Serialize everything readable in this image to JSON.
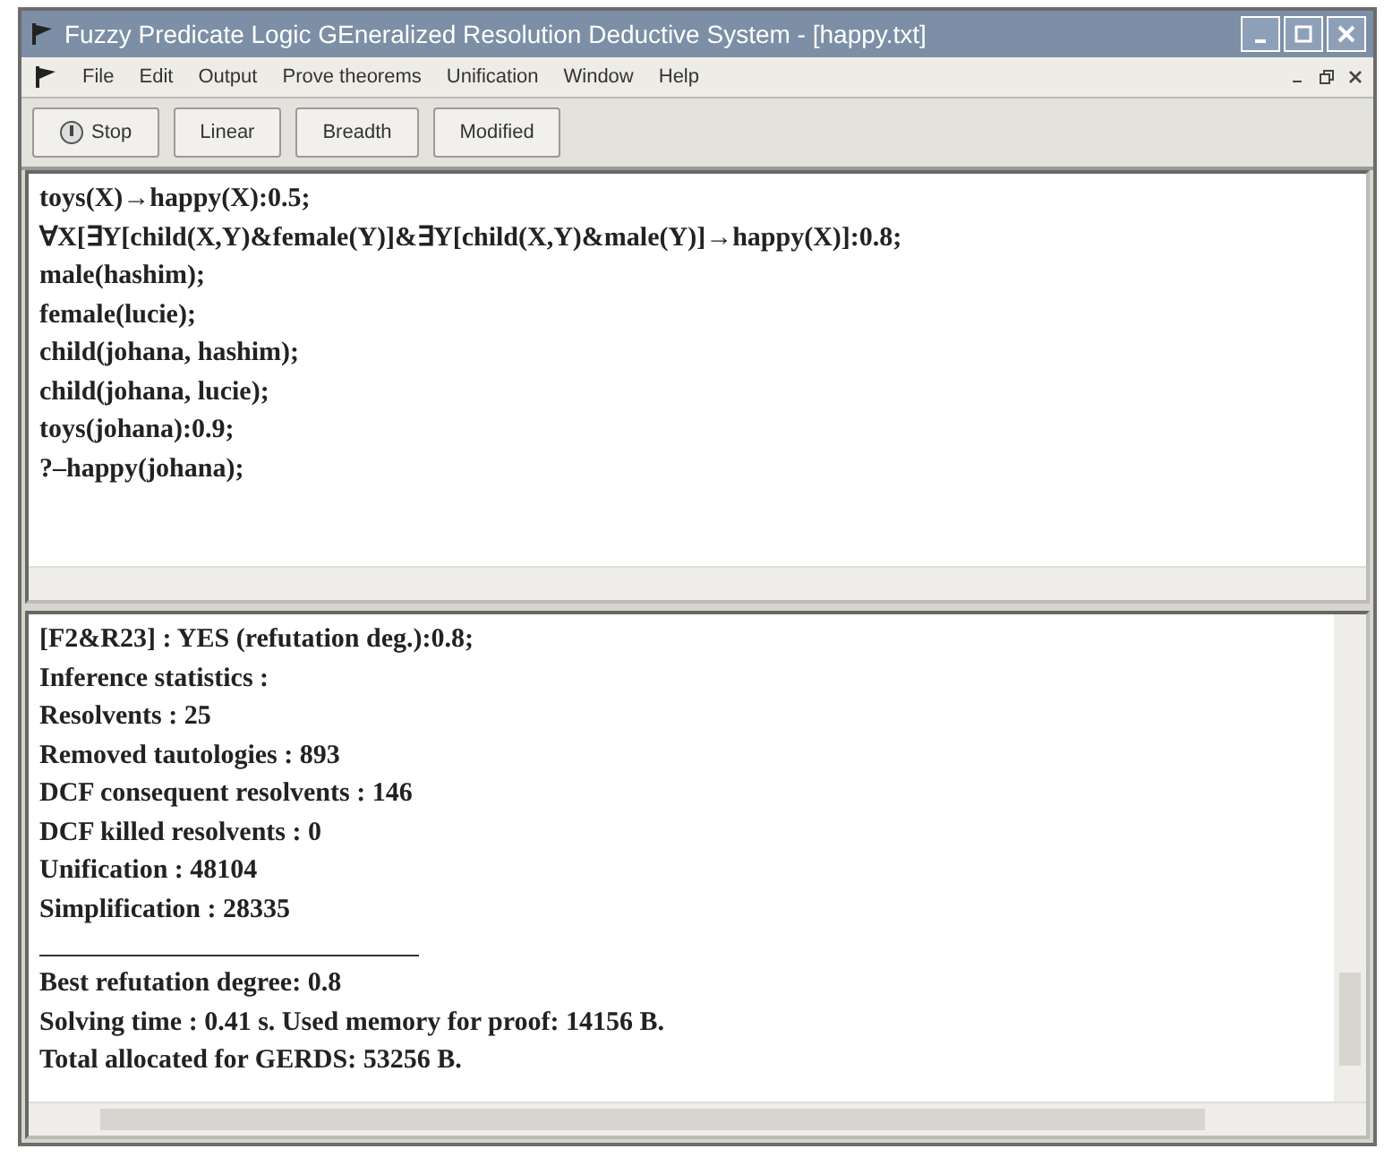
{
  "window": {
    "title": "Fuzzy Predicate Logic GEneralized Resolution Deductive System - [happy.txt]"
  },
  "menu": [
    "File",
    "Edit",
    "Output",
    "Prove theorems",
    "Unification",
    "Window",
    "Help"
  ],
  "toolbar": [
    {
      "label": "Stop",
      "kind": "icon"
    },
    {
      "label": "Linear",
      "kind": "plain"
    },
    {
      "label": "Breadth",
      "kind": "plain"
    },
    {
      "label": "Modified",
      "kind": "plain"
    }
  ],
  "editor": {
    "lines": [
      "toys(X)→happy(X):0.5;",
      "∀X[∃Y[child(X,Y)&female(Y)]&∃Y[child(X,Y)&male(Y)]→happy(X)]:0.8;",
      "male(hashim);",
      "female(lucie);",
      "child(johana, hashim);",
      "child(johana, lucie);",
      "toys(johana):0.9;",
      "?–happy(johana);"
    ]
  },
  "output": {
    "lines": [
      {
        "text": "[F2&R23] :  YES (refutation deg.):0.8;",
        "kind": "text"
      },
      {
        "text": "Inference statistics :",
        "kind": "text"
      },
      {
        "text": "Resolvents : 25",
        "kind": "text"
      },
      {
        "text": "Removed tautologies : 893",
        "kind": "text"
      },
      {
        "text": "DCF consequent resolvents : 146",
        "kind": "text"
      },
      {
        "text": "DCF killed resolvents : 0",
        "kind": "text"
      },
      {
        "text": "Unification : 48104",
        "kind": "text"
      },
      {
        "text": "Simplification : 28335",
        "kind": "text"
      },
      {
        "kind": "rule"
      },
      {
        "text": "Best refutation degree: 0.8",
        "kind": "text"
      },
      {
        "text": "Solving time : 0.41 s. Used memory for proof: 14156 B.",
        "kind": "text"
      },
      {
        "text": "Total allocated for GERDS: 53256 B.",
        "kind": "text"
      }
    ]
  }
}
